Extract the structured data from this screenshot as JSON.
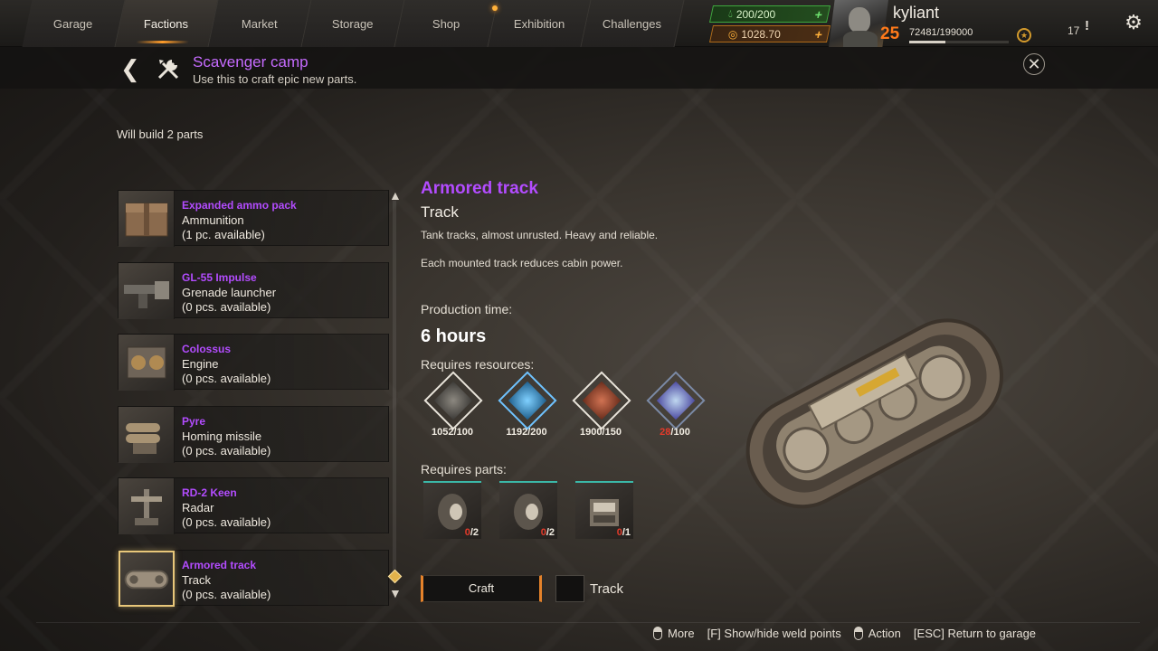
{
  "nav": {
    "tabs": [
      {
        "label": "Garage"
      },
      {
        "label": "Factions"
      },
      {
        "label": "Market"
      },
      {
        "label": "Storage"
      },
      {
        "label": "Shop"
      },
      {
        "label": "Exhibition"
      },
      {
        "label": "Challenges"
      }
    ],
    "active_tab": "Factions"
  },
  "player": {
    "fuel": "200/200",
    "coins": "1028.70",
    "name": "kyliant",
    "level": "25",
    "xp": "72481/199000",
    "xp_progress": 0.364,
    "notifications": "17"
  },
  "header": {
    "title": "Scavenger camp",
    "description": "Use this to craft epic new parts."
  },
  "will_build": "Will build 2 parts",
  "items": [
    {
      "name": "Expanded ammo pack",
      "type": "Ammunition",
      "available": "(1 pc. available)",
      "icon": "ammo-crate"
    },
    {
      "name": "GL-55 Impulse",
      "type": "Grenade launcher",
      "available": "(0 pcs. available)",
      "icon": "grenade-launcher"
    },
    {
      "name": "Colossus",
      "type": "Engine",
      "available": "(0 pcs. available)",
      "icon": "engine"
    },
    {
      "name": "Pyre",
      "type": "Homing missile",
      "available": "(0 pcs. available)",
      "icon": "missile"
    },
    {
      "name": "RD-2 Keen",
      "type": "Radar",
      "available": "(0 pcs. available)",
      "icon": "radar"
    },
    {
      "name": "Armored track",
      "type": "Track",
      "available": "(0 pcs. available)",
      "icon": "track",
      "selected": true
    }
  ],
  "detail": {
    "name": "Armored track",
    "type": "Track",
    "desc1": "Tank tracks, almost unrusted. Heavy and reliable.",
    "desc2": "Each mounted track reduces cabin power.",
    "production_label": "Production time:",
    "production_time": "6 hours",
    "resources_label": "Requires resources:",
    "resources": [
      {
        "have": "1052",
        "need": "/100",
        "icon": "scrap-metal",
        "low": false
      },
      {
        "have": "1192",
        "need": "/200",
        "icon": "wires",
        "low": false
      },
      {
        "have": "1900",
        "need": "/150",
        "icon": "copper",
        "low": false
      },
      {
        "have": "28",
        "need": "/100",
        "icon": "electronics",
        "low": true
      }
    ],
    "parts_label": "Requires parts:",
    "parts": [
      {
        "have": "0",
        "need": "/2",
        "icon": "wheel"
      },
      {
        "have": "0",
        "need": "/2",
        "icon": "wheel"
      },
      {
        "have": "0",
        "need": "/1",
        "icon": "generator"
      }
    ],
    "craft_label": "Craft",
    "checkbox_label": "Track"
  },
  "hints": {
    "more": "More",
    "weld": "[F] Show/hide weld points",
    "action": "Action",
    "esc": "[ESC] Return to garage"
  },
  "colors": {
    "accent_purple": "#b34cff",
    "accent_orange": "#e5822a",
    "fuel_green": "#3ea93e",
    "warning_red": "#e43a2a"
  }
}
